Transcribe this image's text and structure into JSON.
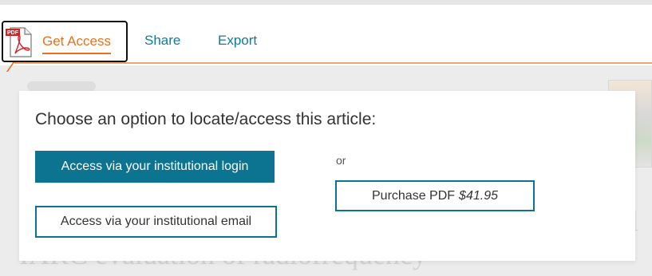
{
  "toolbar": {
    "get_access_label": "Get Access",
    "pdf_icon_text": "PDF",
    "share_label": "Share",
    "export_label": "Export"
  },
  "panel": {
    "heading": "Choose an option to locate/access this article:",
    "institutional_login_label": "Access via your institutional login",
    "or_label": "or",
    "institutional_email_label": "Access via your institutional email",
    "purchase_label": "Purchase PDF",
    "purchase_price": "$41.95"
  },
  "background": {
    "faint_title": "IARC evaluation of radiofrequency",
    "faint_letter": "l"
  },
  "colors": {
    "accent_orange": "#e9711c",
    "link_teal": "#0c7d9d",
    "button_teal": "#0c7391"
  }
}
